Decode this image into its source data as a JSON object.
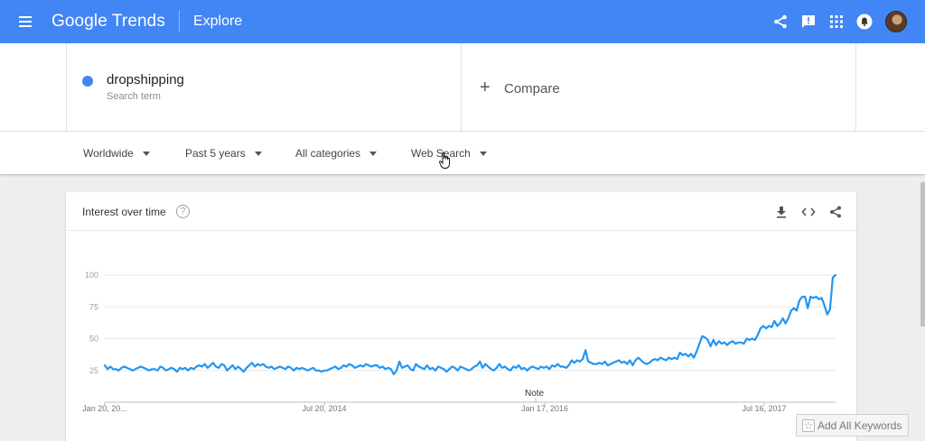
{
  "app": {
    "logo": "Google Trends",
    "title": "Explore"
  },
  "search": {
    "term": "dropshipping",
    "term_subtitle": "Search term",
    "term_color": "#4285f4",
    "compare_label": "Compare"
  },
  "filters": {
    "region": "Worldwide",
    "period": "Past 5 years",
    "category": "All categories",
    "search_type": "Web Search"
  },
  "card": {
    "title": "Interest over time"
  },
  "actions": {
    "add_keywords": "Add All Keywords"
  },
  "chart_data": {
    "type": "line",
    "title": "Interest over time",
    "series": [
      {
        "name": "dropshipping",
        "color": "#2196f3",
        "values": [
          29,
          26,
          28,
          26,
          26,
          25,
          27,
          28,
          27,
          26,
          25,
          26,
          27,
          28,
          27,
          26,
          25,
          26,
          26,
          25,
          28,
          27,
          25,
          26,
          27,
          26,
          24,
          27,
          26,
          27,
          25,
          27,
          26,
          28,
          29,
          28,
          30,
          27,
          29,
          31,
          28,
          27,
          30,
          29,
          25,
          27,
          29,
          26,
          28,
          26,
          24,
          27,
          29,
          31,
          28,
          30,
          29,
          30,
          28,
          27,
          28,
          26,
          27,
          28,
          27,
          26,
          28,
          27,
          25,
          27,
          26,
          27,
          26,
          25,
          26,
          27,
          25,
          25,
          24,
          25,
          25,
          26,
          27,
          28,
          26,
          27,
          29,
          28,
          30,
          29,
          27,
          28,
          29,
          28,
          30,
          29,
          28,
          29,
          29,
          27,
          28,
          26,
          27,
          26,
          22,
          25,
          32,
          27,
          28,
          29,
          26,
          25,
          30,
          28,
          27,
          26,
          29,
          26,
          27,
          25,
          28,
          27,
          26,
          24,
          26,
          28,
          27,
          25,
          28,
          27,
          26,
          25,
          26,
          28,
          29,
          32,
          27,
          30,
          28,
          26,
          25,
          27,
          30,
          27,
          28,
          26,
          25,
          28,
          27,
          29,
          26,
          27,
          25,
          27,
          28,
          27,
          26,
          28,
          27,
          28,
          26,
          29,
          28,
          30,
          28,
          28,
          27,
          29,
          33,
          31,
          33,
          32,
          34,
          41,
          32,
          31,
          30,
          30,
          31,
          30,
          32,
          29,
          30,
          31,
          32,
          33,
          31,
          32,
          30,
          33,
          29,
          33,
          35,
          33,
          31,
          30,
          31,
          33,
          34,
          33,
          35,
          34,
          33,
          35,
          34,
          35,
          34,
          39,
          37,
          38,
          36,
          38,
          35,
          40,
          46,
          52,
          51,
          49,
          44,
          49,
          45,
          48,
          46,
          47,
          45,
          47,
          48,
          46,
          47,
          47,
          46,
          50,
          49,
          50,
          49,
          53,
          58,
          60,
          58,
          60,
          59,
          64,
          60,
          62,
          66,
          62,
          66,
          72,
          74,
          72,
          80,
          83,
          83,
          74,
          83,
          82,
          83,
          81,
          82,
          76,
          69,
          73,
          98,
          100
        ]
      }
    ],
    "x_tick_labels": [
      "Jan 20, 20...",
      "Jul 20, 2014",
      "Jan 17, 2016",
      "Jul 16, 2017"
    ],
    "y_tick_labels": [
      "100",
      "75",
      "50",
      "25"
    ],
    "ylim": [
      0,
      100
    ],
    "annotation": "Note",
    "grid": true
  }
}
